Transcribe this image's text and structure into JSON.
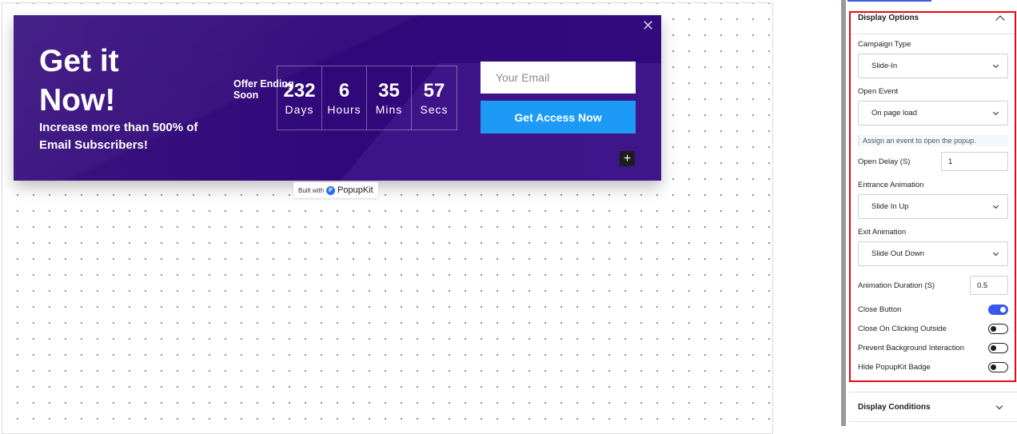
{
  "popup": {
    "heading": "Get it Now!",
    "subheading": "Increase more than 500% of Email Subscribers!",
    "offer_label": "Offer Ending Soon",
    "countdown": [
      {
        "value": "232",
        "unit": "Days"
      },
      {
        "value": "6",
        "unit": "Hours"
      },
      {
        "value": "35",
        "unit": "Mins"
      },
      {
        "value": "57",
        "unit": "Secs"
      }
    ],
    "email_placeholder": "Your Email",
    "cta_label": "Get Access Now",
    "close_icon": "close-icon",
    "add_icon": "plus-icon"
  },
  "badge": {
    "prefix": "Built with",
    "brand": "PopupKit"
  },
  "sidebar": {
    "display_options": {
      "title": "Display Options",
      "campaign_type_label": "Campaign Type",
      "campaign_type_value": "Slide-In",
      "open_event_label": "Open Event",
      "open_event_value": "On page load",
      "open_event_help": "Assign an event to open the popup.",
      "open_delay_label": "Open Delay (S)",
      "open_delay_value": "1",
      "entrance_label": "Entrance Animation",
      "entrance_value": "Slide In Up",
      "exit_label": "Exit Animation",
      "exit_value": "Slide Out Down",
      "duration_label": "Animation Duration (S)",
      "duration_value": "0.5",
      "toggles": [
        {
          "label": "Close Button",
          "on": true
        },
        {
          "label": "Close On Clicking Outside",
          "on": false
        },
        {
          "label": "Prevent Background Interaction",
          "on": false
        },
        {
          "label": "Hide PopupKit Badge",
          "on": false
        }
      ]
    },
    "display_conditions": {
      "title": "Display Conditions"
    }
  },
  "colors": {
    "popup_bg": "#31087a",
    "cta_bg": "#1c9af6",
    "highlight_border": "#e50914",
    "toggle_on": "#3858e9"
  }
}
